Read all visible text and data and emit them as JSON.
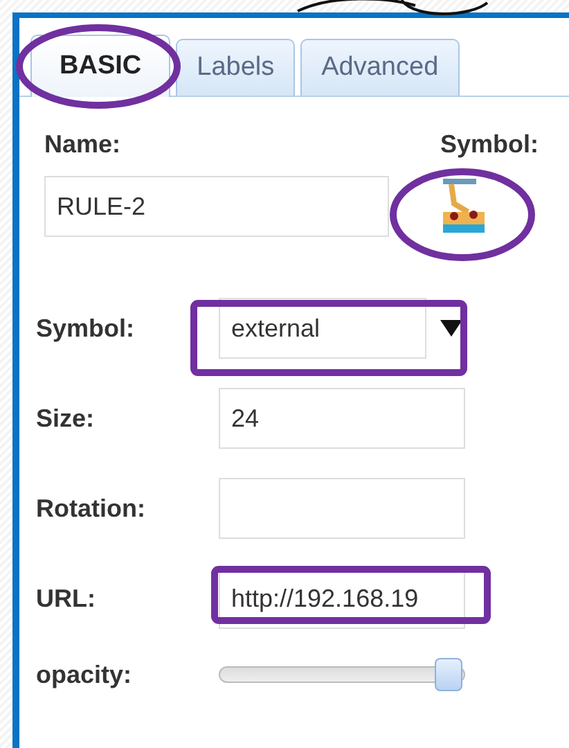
{
  "tabs": [
    {
      "label": "BASIC",
      "selected": true
    },
    {
      "label": "Labels",
      "selected": false
    },
    {
      "label": "Advanced",
      "selected": false
    }
  ],
  "name": {
    "label": "Name:",
    "value": "RULE-2"
  },
  "symbol_preview": {
    "label": "Symbol:"
  },
  "fields": [
    {
      "kind": "select",
      "label": "Symbol:",
      "value": "external"
    },
    {
      "kind": "text",
      "label": "Size:",
      "value": "24"
    },
    {
      "kind": "text",
      "label": "Rotation:"
    },
    {
      "kind": "text",
      "label": "URL:",
      "value": "http://192.168.19"
    },
    {
      "kind": "slider",
      "label": "opacity:",
      "level": 0.93
    }
  ]
}
